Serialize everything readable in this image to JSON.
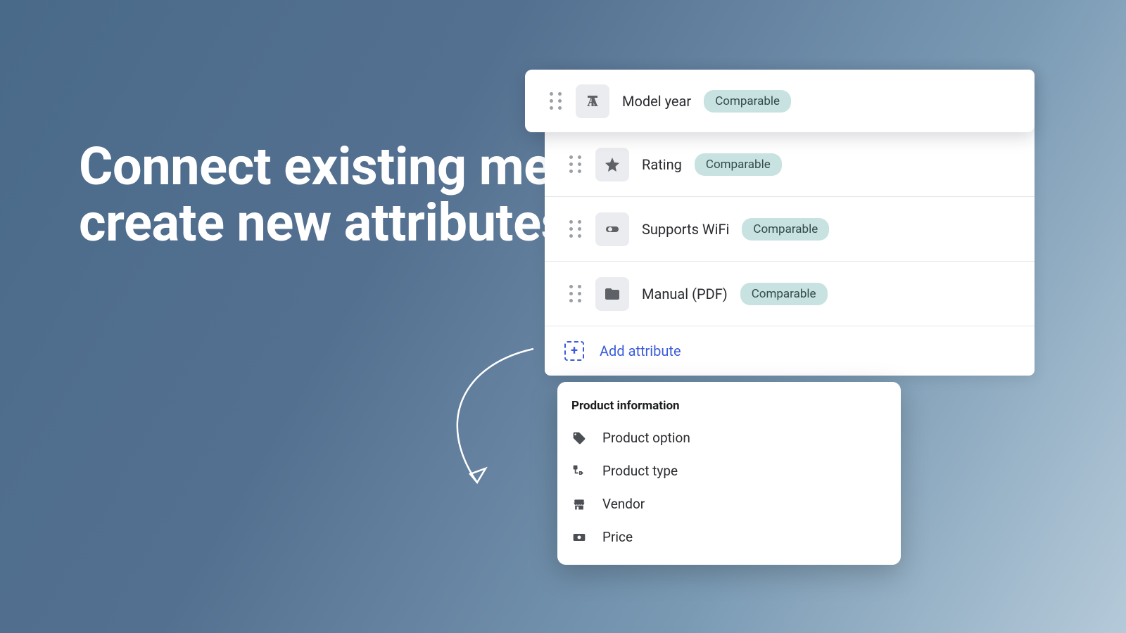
{
  "heading": "Connect existing metafields or\ncreate new attributes",
  "attributes": [
    {
      "label": "Model year",
      "badge": "Comparable",
      "icon": "text"
    },
    {
      "label": "Rating",
      "badge": "Comparable",
      "icon": "star"
    },
    {
      "label": "Supports WiFi",
      "badge": "Comparable",
      "icon": "toggle"
    },
    {
      "label": "Manual (PDF)",
      "badge": "Comparable",
      "icon": "file"
    }
  ],
  "add_label": "Add attribute",
  "dropdown": {
    "header": "Product information",
    "items": [
      {
        "label": "Product option",
        "icon": "tag"
      },
      {
        "label": "Product type",
        "icon": "tree-tag"
      },
      {
        "label": "Vendor",
        "icon": "store"
      },
      {
        "label": "Price",
        "icon": "price"
      }
    ]
  }
}
